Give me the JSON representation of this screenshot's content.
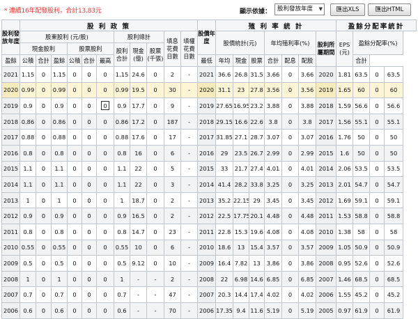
{
  "header": {
    "note": "* 連續16年配發股利，合計13.83元",
    "sort_label": "顯示依據：",
    "sort_value": "股利發放年度",
    "xls_button": "匯出XLS",
    "html_button": "匯出HTML"
  },
  "table": {
    "group_dividend_policy": "股 利 政 策",
    "group_yield": "殖 利 率 統 計",
    "group_payout": "盈餘分配率統計",
    "h_year": "股利發放年度",
    "h_shareholder_div": "股東股利 (元/股)",
    "h_div_total": "股利總計",
    "h_fill_div": "填息花費日數",
    "h_fill_right": "填權花費日數",
    "h_cash_div": "現金股利",
    "h_stock_div": "股票股利",
    "h_surplus": "盈餘",
    "h_reserve": "公積",
    "h_subtotal": "合計",
    "h_total2": "股利合計",
    "h_cash_100m": "現金(億)",
    "h_stock_1k": "股票(千張)",
    "h_stock_year": "股價年度",
    "h_price_stats": "股價統計(元)",
    "h_annual_yield": "年均殖利率(%)",
    "h_high": "最高",
    "h_low": "最低",
    "h_avg": "年均",
    "h_cash": "現金",
    "h_stock": "股票",
    "h_profit_period": "股利所屬期間",
    "h_eps": "EPS (元)",
    "h_payout_rate": "盈餘分配率(%)",
    "h_pay_cash": "配息",
    "h_pay_stock": "配股",
    "rows": [
      {
        "y": "2021",
        "cs": "1.15",
        "cr": "0",
        "ct": "1.15",
        "ss": "0",
        "sr": "0",
        "st": "0",
        "tot": "1.15",
        "cash": "24.6",
        "stk": "0",
        "fd": "2",
        "fr": "-",
        "py": "2021",
        "hi": "36.6",
        "lo": "26.8",
        "avg": "31.5",
        "yc": "3.66",
        "ys": "0",
        "yt": "3.66",
        "pp": "2020",
        "eps": "1.81",
        "pc": "63.5",
        "ps": "0",
        "pt": "63.5"
      },
      {
        "y": "2020",
        "cs": "0.99",
        "cr": "0",
        "ct": "0.99",
        "ss": "0",
        "sr": "0",
        "st": "0",
        "tot": "0.99",
        "cash": "19.5",
        "stk": "0",
        "fd": "30",
        "fr": "-",
        "py": "2020",
        "hi": "31.1",
        "lo": "23",
        "avg": "27.8",
        "yc": "3.56",
        "ys": "0",
        "yt": "3.56",
        "pp": "2019",
        "eps": "1.65",
        "pc": "60",
        "ps": "0",
        "pt": "60",
        "hl": true
      },
      {
        "y": "2019",
        "cs": "0.9",
        "cr": "0",
        "ct": "0.9",
        "ss": "0",
        "sr": "0",
        "st": "0",
        "tot": "0.9",
        "cash": "17.7",
        "stk": "0",
        "fd": "9",
        "fr": "-",
        "py": "2019",
        "hi": "27.65",
        "lo": "16.95",
        "avg": "23.2",
        "yc": "3.88",
        "ys": "0",
        "yt": "3.88",
        "pp": "2018",
        "eps": "1.59",
        "pc": "56.6",
        "ps": "0",
        "pt": "56.6"
      },
      {
        "y": "2018",
        "cs": "0.86",
        "cr": "0",
        "ct": "0.86",
        "ss": "0",
        "sr": "0",
        "st": "0",
        "tot": "0.86",
        "cash": "17.2",
        "stk": "0",
        "fd": "187",
        "fr": "-",
        "py": "2018",
        "hi": "29.15",
        "lo": "16.6",
        "avg": "22.6",
        "yc": "3.8",
        "ys": "0",
        "yt": "3.8",
        "pp": "2017",
        "eps": "1.56",
        "pc": "55.1",
        "ps": "0",
        "pt": "55.1"
      },
      {
        "y": "2017",
        "cs": "0.88",
        "cr": "0",
        "ct": "0.88",
        "ss": "0",
        "sr": "0",
        "st": "0",
        "tot": "0.88",
        "cash": "17.6",
        "stk": "0",
        "fd": "17",
        "fr": "-",
        "py": "2017",
        "hi": "31.85",
        "lo": "27.1",
        "avg": "28.7",
        "yc": "3.07",
        "ys": "0",
        "yt": "3.07",
        "pp": "2016",
        "eps": "1.76",
        "pc": "50",
        "ps": "0",
        "pt": "50"
      },
      {
        "y": "2016",
        "cs": "0.8",
        "cr": "0",
        "ct": "0.8",
        "ss": "0",
        "sr": "0",
        "st": "0",
        "tot": "0.8",
        "cash": "16",
        "stk": "0",
        "fd": "6",
        "fr": "-",
        "py": "2016",
        "hi": "29",
        "lo": "23.5",
        "avg": "26.7",
        "yc": "2.99",
        "ys": "0",
        "yt": "2.99",
        "pp": "2015",
        "eps": "1.6",
        "pc": "50",
        "ps": "0",
        "pt": "50"
      },
      {
        "y": "2015",
        "cs": "1.1",
        "cr": "0",
        "ct": "1.1",
        "ss": "0",
        "sr": "0",
        "st": "0",
        "tot": "1.1",
        "cash": "22",
        "stk": "0",
        "fd": "5",
        "fr": "-",
        "py": "2015",
        "hi": "33",
        "lo": "21.7",
        "avg": "27.4",
        "yc": "4.01",
        "ys": "0",
        "yt": "4.01",
        "pp": "2014",
        "eps": "2.06",
        "pc": "53.5",
        "ps": "0",
        "pt": "53.5"
      },
      {
        "y": "2014",
        "cs": "1.1",
        "cr": "0",
        "ct": "1.1",
        "ss": "0",
        "sr": "0",
        "st": "0",
        "tot": "1.1",
        "cash": "22",
        "stk": "0",
        "fd": "3",
        "fr": "-",
        "py": "2014",
        "hi": "41.4",
        "lo": "28.2",
        "avg": "33.8",
        "yc": "3.25",
        "ys": "0",
        "yt": "3.25",
        "pp": "2013",
        "eps": "2.01",
        "pc": "54.7",
        "ps": "0",
        "pt": "54.7"
      },
      {
        "y": "2013",
        "cs": "1",
        "cr": "0",
        "ct": "1",
        "ss": "0",
        "sr": "0",
        "st": "0",
        "tot": "1",
        "cash": "18.7",
        "stk": "0",
        "fd": "2",
        "fr": "-",
        "py": "2013",
        "hi": "35.2",
        "lo": "22.15",
        "avg": "29",
        "yc": "3.45",
        "ys": "0",
        "yt": "3.45",
        "pp": "2012",
        "eps": "1.69",
        "pc": "59.1",
        "ps": "0",
        "pt": "59.1"
      },
      {
        "y": "2012",
        "cs": "0.9",
        "cr": "0",
        "ct": "0.9",
        "ss": "0",
        "sr": "0",
        "st": "0",
        "tot": "0.9",
        "cash": "16.5",
        "stk": "0",
        "fd": "2",
        "fr": "-",
        "py": "2012",
        "hi": "22.5",
        "lo": "17.75",
        "avg": "20.1",
        "yc": "4.48",
        "ys": "0",
        "yt": "4.48",
        "pp": "2011",
        "eps": "1.53",
        "pc": "58.8",
        "ps": "0",
        "pt": "58.8"
      },
      {
        "y": "2011",
        "cs": "0.8",
        "cr": "0",
        "ct": "0.8",
        "ss": "0",
        "sr": "0",
        "st": "0",
        "tot": "0.8",
        "cash": "14.7",
        "stk": "0",
        "fd": "23",
        "fr": "-",
        "py": "2011",
        "hi": "22.8",
        "lo": "15.3",
        "avg": "19.6",
        "yc": "4.08",
        "ys": "0",
        "yt": "4.08",
        "pp": "2010",
        "eps": "1.38",
        "pc": "58",
        "ps": "0",
        "pt": "58"
      },
      {
        "y": "2010",
        "cs": "0.55",
        "cr": "0",
        "ct": "0.55",
        "ss": "0",
        "sr": "0",
        "st": "0",
        "tot": "0.55",
        "cash": "10",
        "stk": "0",
        "fd": "6",
        "fr": "-",
        "py": "2010",
        "hi": "18.6",
        "lo": "13",
        "avg": "15.4",
        "yc": "3.57",
        "ys": "0",
        "yt": "3.57",
        "pp": "2009",
        "eps": "1.05",
        "pc": "50.9",
        "ps": "0",
        "pt": "50.9"
      },
      {
        "y": "2009",
        "cs": "0.5",
        "cr": "0",
        "ct": "0.5",
        "ss": "0",
        "sr": "0",
        "st": "0",
        "tot": "0.5",
        "cash": "9.12",
        "stk": "0",
        "fd": "10",
        "fr": "-",
        "py": "2009",
        "hi": "16.4",
        "lo": "7.82",
        "avg": "13",
        "yc": "3.86",
        "ys": "0",
        "yt": "3.86",
        "pp": "2008",
        "eps": "0.95",
        "pc": "52.6",
        "ps": "0",
        "pt": "52.6"
      },
      {
        "y": "2008",
        "cs": "1",
        "cr": "0",
        "ct": "1",
        "ss": "0",
        "sr": "0",
        "st": "0",
        "tot": "1",
        "cash": "-",
        "stk": "-",
        "fd": "2",
        "fr": "-",
        "py": "2008",
        "hi": "22",
        "lo": "6.98",
        "avg": "14.6",
        "yc": "6.85",
        "ys": "0",
        "yt": "6.85",
        "pp": "2007",
        "eps": "1.46",
        "pc": "68.5",
        "ps": "0",
        "pt": "68.5"
      },
      {
        "y": "2007",
        "cs": "0.7",
        "cr": "0",
        "ct": "0.7",
        "ss": "0",
        "sr": "0",
        "st": "0",
        "tot": "0.7",
        "cash": "-",
        "stk": "-",
        "fd": "47",
        "fr": "-",
        "py": "2007",
        "hi": "20.3",
        "lo": "14.4",
        "avg": "17.4",
        "yc": "4.02",
        "ys": "0",
        "yt": "4.02",
        "pp": "2006",
        "eps": "1.55",
        "pc": "45.2",
        "ps": "0",
        "pt": "45.2"
      },
      {
        "y": "2006",
        "cs": "0.6",
        "cr": "0",
        "ct": "0.6",
        "ss": "0",
        "sr": "0",
        "st": "0",
        "tot": "0.6",
        "cash": "-",
        "stk": "-",
        "fd": "70",
        "fr": "-",
        "py": "2006",
        "hi": "17.35",
        "lo": "9.4",
        "avg": "11.6",
        "yc": "5.19",
        "ys": "0",
        "yt": "5.19",
        "pp": "2005",
        "eps": "0.97",
        "pc": "61.9",
        "ps": "0",
        "pt": "61.9"
      }
    ]
  }
}
